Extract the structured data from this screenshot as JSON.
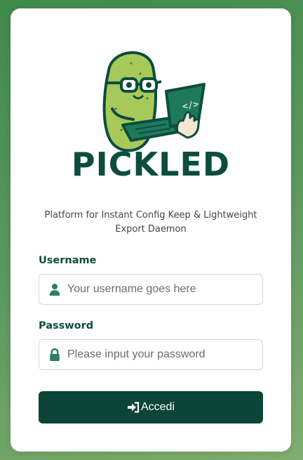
{
  "brand": {
    "name": "PICKLED",
    "tagline": "Platform for Instant Config Keep & Lightweight Export Daemon"
  },
  "form": {
    "username": {
      "label": "Username",
      "placeholder": "Your username goes here",
      "value": "",
      "icon": "user-icon"
    },
    "password": {
      "label": "Password",
      "placeholder": "Please input your password",
      "value": "",
      "icon": "lock-icon"
    },
    "submit": {
      "label": "Accedi",
      "icon": "sign-in-icon"
    }
  },
  "colors": {
    "primary": "#0c4437",
    "brand_text": "#0c4d3e",
    "pickle_green": "#a6c95a",
    "background_green": "#5f9a5f"
  }
}
